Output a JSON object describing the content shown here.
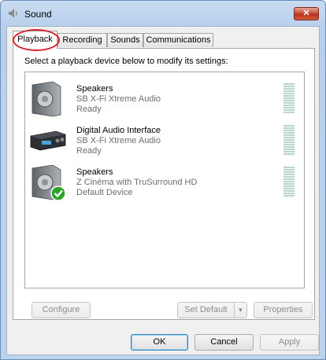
{
  "window": {
    "title": "Sound",
    "close_glyph": "✕"
  },
  "tabs": [
    {
      "label": "Playback",
      "active": true
    },
    {
      "label": "Recording",
      "active": false
    },
    {
      "label": "Sounds",
      "active": false
    },
    {
      "label": "Communications",
      "active": false
    }
  ],
  "panel": {
    "instructions": "Select a playback device below to modify its settings:",
    "devices": [
      {
        "name": "Speakers",
        "description": "SB X-Fi Xtreme Audio",
        "status": "Ready",
        "icon": "speaker-icon"
      },
      {
        "name": "Digital Audio Interface",
        "description": "SB X-Fi Xtreme Audio",
        "status": "Ready",
        "icon": "digital-audio-interface-icon"
      },
      {
        "name": "Speakers",
        "description": "Z Cinéma with TruSurround HD",
        "status": "Default Device",
        "icon": "speaker-default-icon"
      }
    ],
    "buttons": {
      "configure": "Configure",
      "set_default": "Set Default",
      "properties": "Properties"
    }
  },
  "footer": {
    "ok": "OK",
    "cancel": "Cancel",
    "apply": "Apply"
  },
  "colors": {
    "highlight_ring": "#d8202a",
    "default_check": "#2aa52a"
  }
}
